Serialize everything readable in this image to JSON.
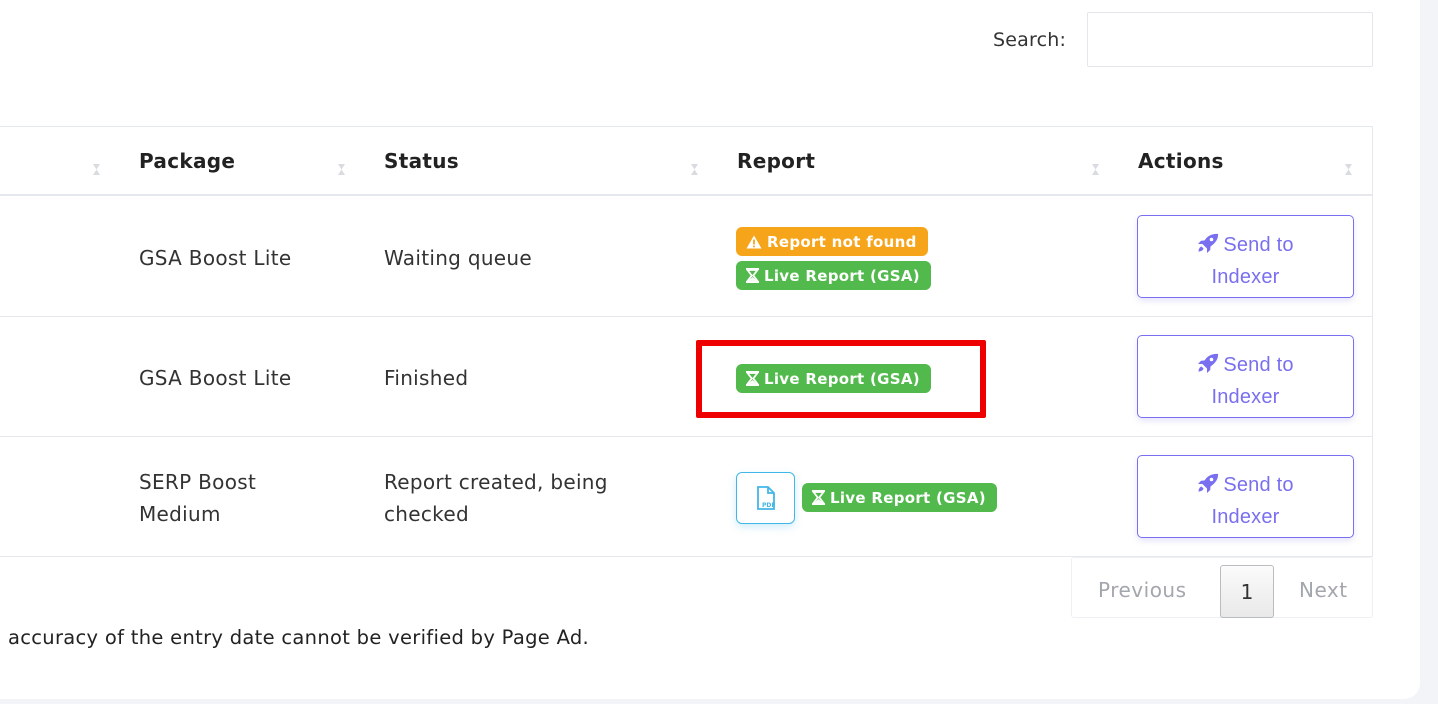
{
  "search": {
    "label": "Search:",
    "value": ""
  },
  "table": {
    "headers": {
      "package": "Package",
      "status": "Status",
      "report": "Report",
      "actions": "Actions"
    },
    "rows": [
      {
        "package": "GSA Boost Lite",
        "status": "Waiting queue",
        "badges": {
          "warning": "Report not found",
          "live": "Live Report (GSA)"
        },
        "action_line1": "Send to",
        "action_line2": "Indexer"
      },
      {
        "package": "GSA Boost Lite",
        "status": "Finished",
        "badges": {
          "live": "Live Report (GSA)"
        },
        "action_line1": "Send to",
        "action_line2": "Indexer"
      },
      {
        "package_line1": "SERP Boost",
        "package_line2": "Medium",
        "status_line1": "Report created, being",
        "status_line2": "checked",
        "pdf_label": "PDF",
        "badges": {
          "live": "Live Report (GSA)"
        },
        "action_line1": "Send to",
        "action_line2": "Indexer"
      }
    ]
  },
  "pagination": {
    "previous": "Previous",
    "current": "1",
    "next": "Next"
  },
  "footer_note": "accuracy of the entry date cannot be verified by Page Ad.",
  "colors": {
    "warning": "#f6a51a",
    "success": "#52b94c",
    "accent": "#7a6ff0",
    "highlight": "#ee0000",
    "pdf": "#43b6e8"
  },
  "icons": {
    "warning": "warning-triangle-icon",
    "live": "hourglass-icon",
    "action": "rocket-icon",
    "pdf": "pdf-file-icon",
    "sort": "sort-icon"
  }
}
